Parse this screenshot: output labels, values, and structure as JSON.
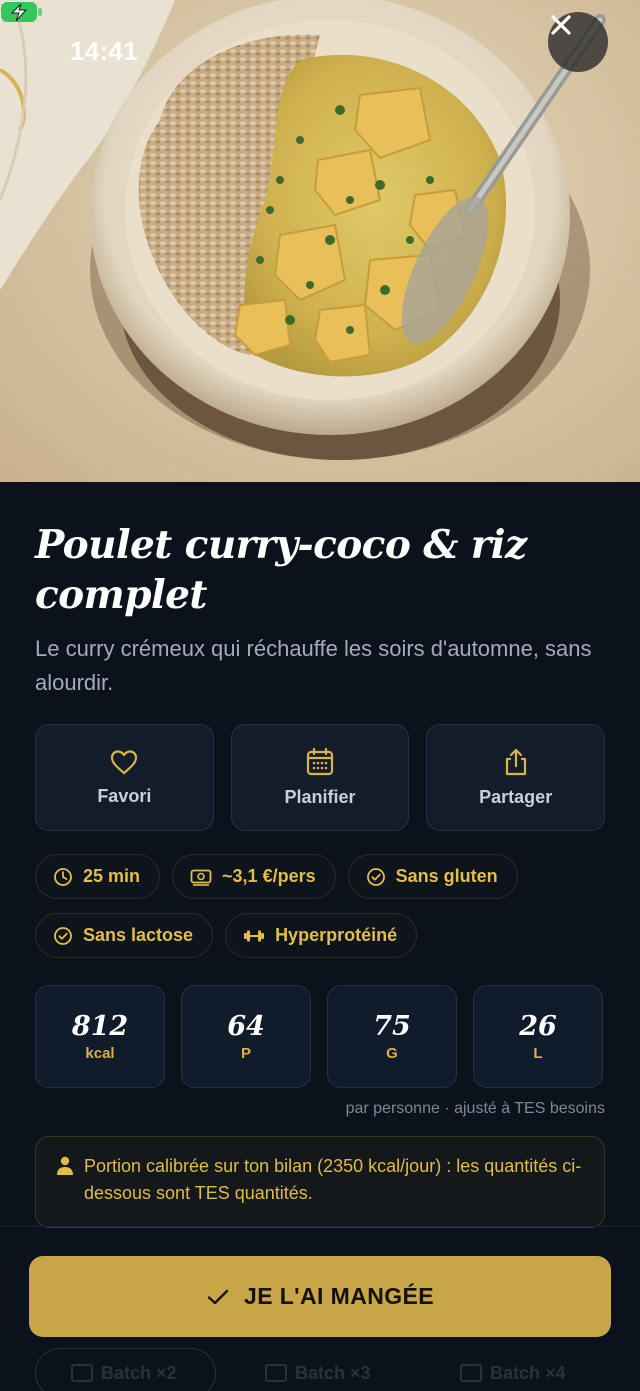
{
  "status_bar": {
    "time": "14:41"
  },
  "recipe": {
    "title": "Poulet curry-coco & riz complet",
    "subtitle": "Le curry crémeux qui réchauffe les soirs d'automne, sans alourdir."
  },
  "actions": [
    {
      "label": "Favori",
      "icon": "heart-icon"
    },
    {
      "label": "Planifier",
      "icon": "calendar-icon"
    },
    {
      "label": "Partager",
      "icon": "share-icon"
    }
  ],
  "tags": [
    {
      "label": "25 min",
      "icon": "clock-icon"
    },
    {
      "label": "~3,1 €/pers",
      "icon": "money-icon"
    },
    {
      "label": "Sans gluten",
      "icon": "check-circle-icon"
    },
    {
      "label": "Sans lactose",
      "icon": "check-circle-icon"
    },
    {
      "label": "Hyperprotéiné",
      "icon": "dumbbell-icon"
    }
  ],
  "macros": [
    {
      "value": "812",
      "unit": "kcal"
    },
    {
      "value": "64",
      "unit": "P"
    },
    {
      "value": "75",
      "unit": "G"
    },
    {
      "value": "26",
      "unit": "L"
    }
  ],
  "macros_note": "par personne · ajusté à TES besoins",
  "portion_note": "Portion calibrée sur ton bilan (2350 kcal/jour) : les quantités ci-dessous sont TES quantités.",
  "cta": {
    "label": "JE L'AI MANGÉE"
  },
  "batch_options": [
    "Batch ×2",
    "Batch ×3",
    "Batch ×4"
  ],
  "colors": {
    "accent": "#c8a547",
    "tag_text": "#e3bd48",
    "background": "#0b121c",
    "card": "#121c2b"
  }
}
